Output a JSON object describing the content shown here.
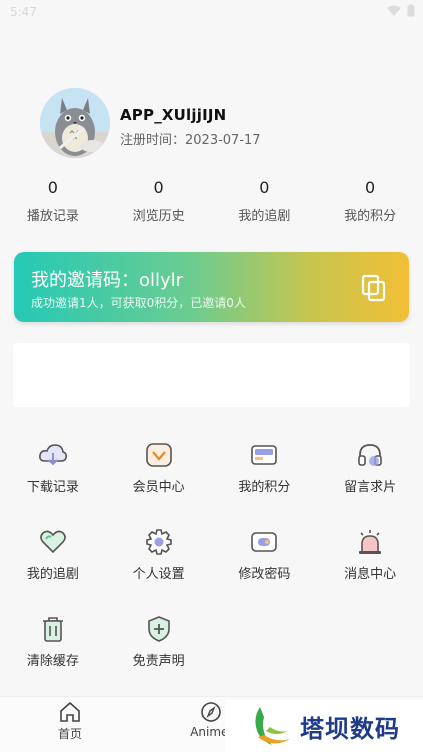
{
  "status_bar": {
    "time": "5:47"
  },
  "profile": {
    "username": "APP_XUljjIJN",
    "reg_label": "注册时间：",
    "reg_date": "2023-07-17"
  },
  "stats": [
    {
      "value": "0",
      "label": "播放记录"
    },
    {
      "value": "0",
      "label": "浏览历史"
    },
    {
      "value": "0",
      "label": "我的追剧"
    },
    {
      "value": "0",
      "label": "我的积分"
    }
  ],
  "invite": {
    "title": "我的邀请码：ollylr",
    "desc": "成功邀请1人，可获取0积分，已邀请0人"
  },
  "menu": [
    {
      "label": "下载记录",
      "icon": "cloud-download-icon"
    },
    {
      "label": "会员中心",
      "icon": "vip-diamond-icon"
    },
    {
      "label": "我的积分",
      "icon": "wallet-card-icon"
    },
    {
      "label": "留言求片",
      "icon": "headphones-icon"
    },
    {
      "label": "我的追剧",
      "icon": "heart-icon"
    },
    {
      "label": "个人设置",
      "icon": "gear-icon"
    },
    {
      "label": "修改密码",
      "icon": "lock-icon"
    },
    {
      "label": "消息中心",
      "icon": "alarm-icon"
    },
    {
      "label": "清除缓存",
      "icon": "trash-icon"
    },
    {
      "label": "免责声明",
      "icon": "shield-icon"
    }
  ],
  "tabs": [
    {
      "label": "首页",
      "icon": "home-icon"
    },
    {
      "label": "Animel",
      "icon": "compass-icon"
    }
  ],
  "watermark": {
    "text": "塔坝数码"
  },
  "colors": {
    "accent_teal": "#25c9b6",
    "accent_yellow": "#f2bf36",
    "icon_purple": "#8f8fd8",
    "icon_green": "#5fc58e"
  }
}
